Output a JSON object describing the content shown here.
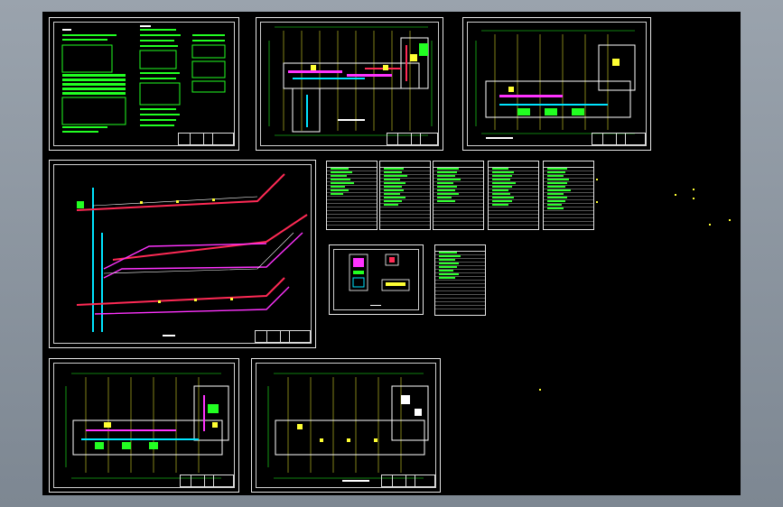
{
  "viewer": {
    "background_color": "#000000",
    "accent_colors": {
      "grid_green": "#22ff22",
      "pipe_red": "#ff2a55",
      "pipe_magenta": "#ff33ff",
      "pipe_blue": "#3355ff",
      "yellow": "#ffff33",
      "cyan": "#00e5ff"
    }
  },
  "sheets": [
    {
      "name": "notes-sheet",
      "kind": "text-notes"
    },
    {
      "name": "floor-plan-1",
      "kind": "plan"
    },
    {
      "name": "floor-plan-2",
      "kind": "plan"
    },
    {
      "name": "pipe-system-diagram",
      "kind": "isometric"
    },
    {
      "name": "equipment-table-1",
      "kind": "table"
    },
    {
      "name": "equipment-table-2",
      "kind": "table"
    },
    {
      "name": "equipment-table-3",
      "kind": "table"
    },
    {
      "name": "equipment-table-4",
      "kind": "table"
    },
    {
      "name": "equipment-table-5",
      "kind": "table"
    },
    {
      "name": "detail-sheet",
      "kind": "detail"
    },
    {
      "name": "equipment-table-6",
      "kind": "table"
    },
    {
      "name": "floor-plan-3",
      "kind": "plan"
    },
    {
      "name": "floor-plan-4",
      "kind": "plan"
    }
  ]
}
